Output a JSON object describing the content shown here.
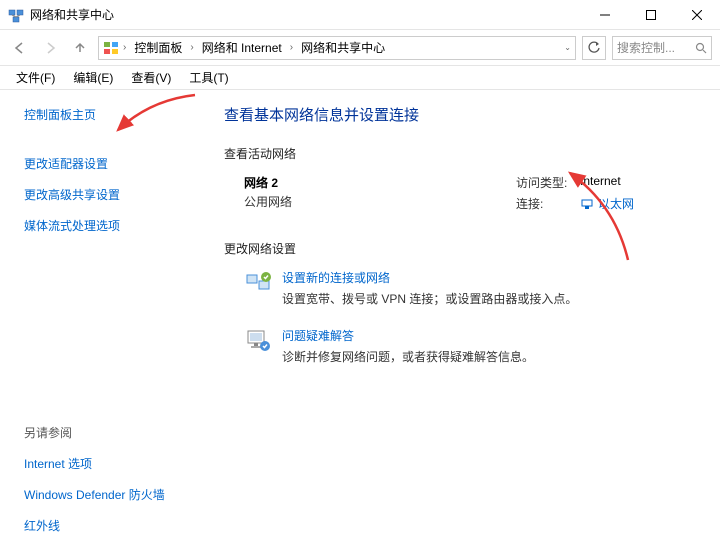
{
  "window": {
    "title": "网络和共享中心"
  },
  "breadcrumb": {
    "items": [
      "控制面板",
      "网络和 Internet",
      "网络和共享中心"
    ]
  },
  "search": {
    "placeholder": "搜索控制..."
  },
  "menubar": {
    "file": "文件(F)",
    "edit": "编辑(E)",
    "view": "查看(V)",
    "tools": "工具(T)"
  },
  "sidebar": {
    "home": "控制面板主页",
    "adapter": "更改适配器设置",
    "advanced": "更改高级共享设置",
    "media": "媒体流式处理选项",
    "seealso_label": "另请参阅",
    "internet_options": "Internet 选项",
    "defender": "Windows Defender 防火墙",
    "infrared": "红外线"
  },
  "main": {
    "heading": "查看基本网络信息并设置连接",
    "active_networks_label": "查看活动网络",
    "network": {
      "name": "网络 2",
      "type": "公用网络",
      "access_type_label": "访问类型:",
      "access_type_value": "Internet",
      "connections_label": "连接:",
      "connections_value": "以太网"
    },
    "change_settings_label": "更改网络设置",
    "task_setup": {
      "title": "设置新的连接或网络",
      "desc": "设置宽带、拨号或 VPN 连接；或设置路由器或接入点。"
    },
    "task_trouble": {
      "title": "问题疑难解答",
      "desc": "诊断并修复网络问题，或者获得疑难解答信息。"
    }
  }
}
